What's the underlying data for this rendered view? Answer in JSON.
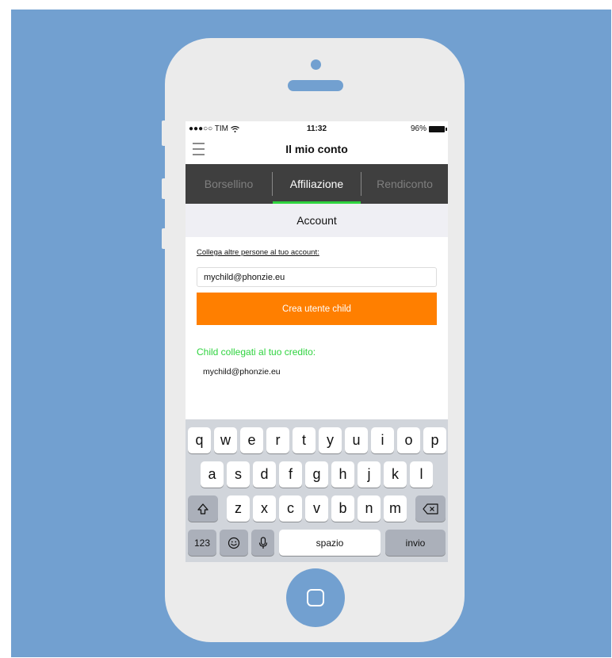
{
  "status_bar": {
    "carrier": "●●●○○ TIM",
    "time": "11:32",
    "battery": "96%"
  },
  "nav": {
    "title": "Il mio conto"
  },
  "tabs": [
    {
      "label": "Borsellino",
      "active": false
    },
    {
      "label": "Affiliazione",
      "active": true
    },
    {
      "label": "Rendiconto",
      "active": false
    }
  ],
  "section": {
    "title": "Account"
  },
  "form": {
    "link_label": "Collega altre persone al tuo account:",
    "email_value": "mychild@phonzie.eu",
    "create_button": "Crea utente child"
  },
  "linked": {
    "title": "Child collegati al tuo credito:",
    "items": [
      "mychild@phonzie.eu"
    ]
  },
  "keyboard": {
    "row1": [
      "q",
      "w",
      "e",
      "r",
      "t",
      "y",
      "u",
      "i",
      "o",
      "p"
    ],
    "row2": [
      "a",
      "s",
      "d",
      "f",
      "g",
      "h",
      "j",
      "k",
      "l"
    ],
    "row3": [
      "z",
      "x",
      "c",
      "v",
      "b",
      "n",
      "m"
    ],
    "numbers_key": "123",
    "space_key": "spazio",
    "return_key": "invio"
  },
  "colors": {
    "background": "#72a0d0",
    "accent_orange": "#ff7f00",
    "accent_green": "#2fd33f",
    "tab_bar": "#3f3f3f"
  }
}
